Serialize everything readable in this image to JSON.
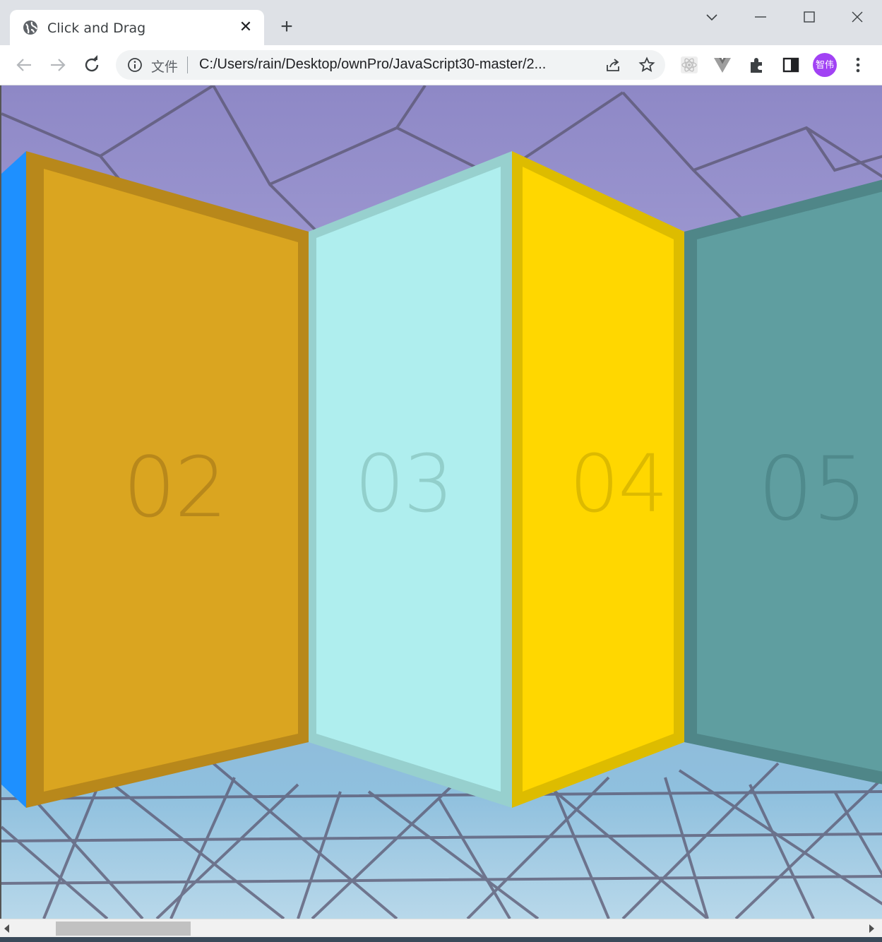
{
  "browser": {
    "tab": {
      "title": "Click and Drag",
      "close": "✕"
    },
    "new_tab": "+",
    "address": {
      "scheme": "文件",
      "url": "C:/Users/rain/Desktop/ownPro/JavaScript30-master/2..."
    },
    "profile": "智伟"
  },
  "page": {
    "panels": [
      {
        "label": "02",
        "fill": "#DAA520",
        "border": "#B8881B",
        "label_color": "#B8881B"
      },
      {
        "label": "03",
        "fill": "#AFEEEE",
        "border": "#97D0CE",
        "label_color": "#92CFCB"
      },
      {
        "label": "04",
        "fill": "#FFD700",
        "border": "#DDBC00",
        "label_color": "#DDBA00"
      },
      {
        "label": "05",
        "fill": "#5F9EA0",
        "border": "#4F8688",
        "label_color": "#4F8A8C"
      }
    ],
    "edge_panel_color": "#1E90FF"
  }
}
